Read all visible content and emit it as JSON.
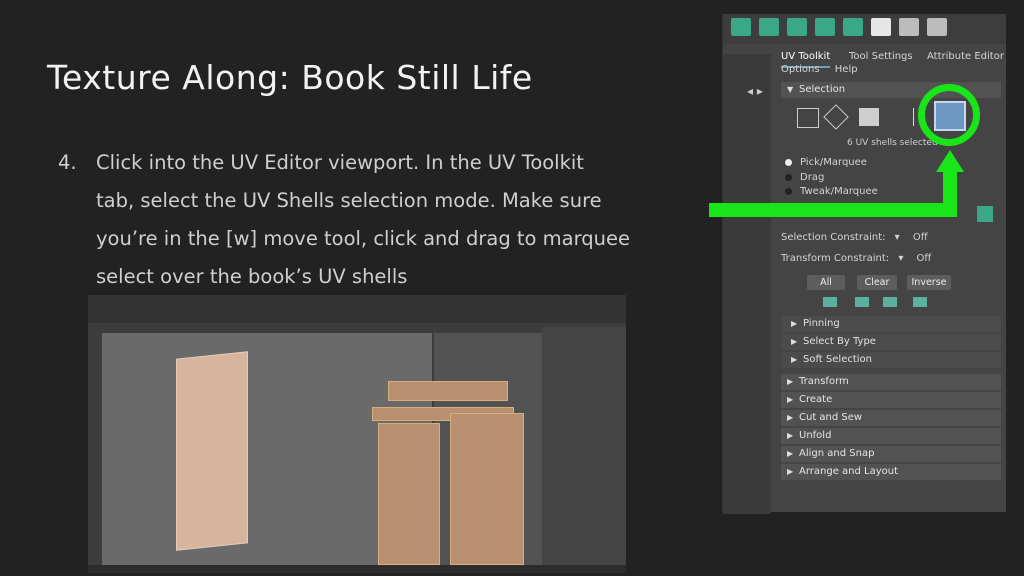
{
  "slide": {
    "title": "Texture Along: Book Still Life",
    "step_number": "4.",
    "step_lines": [
      "Click into the UV Editor viewport. In the UV Toolkit",
      "tab, select the UV Shells selection mode. Make sure",
      "you’re in the [w] move tool, click and drag to marquee",
      "select over the book’s UV shells"
    ]
  },
  "maya_panel": {
    "tabs": [
      "UV Toolkit",
      "Tool Settings",
      "Attribute Editor"
    ],
    "menu": [
      "Options",
      "Help"
    ],
    "selection_label": "Selection",
    "selection_status": "6 UV shells selected",
    "radio_options": [
      {
        "label": "Pick/Marquee",
        "selected": true
      },
      {
        "label": "Drag",
        "selected": false
      },
      {
        "label": "Tweak/Marquee",
        "selected": false
      }
    ],
    "selection_constraint": {
      "label": "Selection Constraint:",
      "value": "Off"
    },
    "transform_constraint": {
      "label": "Transform Constraint:",
      "value": "Off"
    },
    "buttons": [
      "All",
      "Clear",
      "Inverse"
    ],
    "subsections": [
      "Pinning",
      "Select By Type",
      "Soft Selection"
    ],
    "sections": [
      "Transform",
      "Create",
      "Cut and Sew",
      "Unfold",
      "Align and Snap",
      "Arrange and Layout"
    ]
  },
  "colors": {
    "highlight": "#19e619",
    "panel_bg": "#444444",
    "slide_bg": "#222222"
  }
}
